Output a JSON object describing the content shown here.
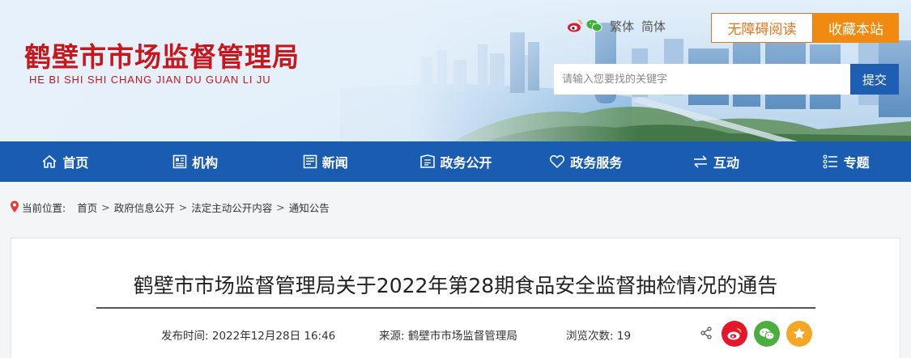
{
  "header": {
    "site_title": "鹤壁市市场监督管理局",
    "site_pinyin": "HE BI SHI SHI CHANG JIAN DU GUAN LI JU",
    "social_icons": [
      "weibo-icon",
      "wechat-icon"
    ],
    "lang_traditional": "繁体",
    "lang_simplified": "简体",
    "accessibility_label": "无障碍阅读",
    "favorite_label": "收藏本站",
    "search_placeholder": "请输入您要找的关键字",
    "search_button": "提交",
    "colors": {
      "title_red": "#c8161d",
      "fav_orange": "#f08a10",
      "nav_blue": "#1b5cb3"
    }
  },
  "nav": {
    "items": [
      {
        "label": "首页",
        "icon": "home-icon"
      },
      {
        "label": "机构",
        "icon": "org-icon"
      },
      {
        "label": "新闻",
        "icon": "news-icon"
      },
      {
        "label": "政务公开",
        "icon": "open-gov-icon"
      },
      {
        "label": "政务服务",
        "icon": "heart-icon"
      },
      {
        "label": "互动",
        "icon": "exchange-icon"
      },
      {
        "label": "专题",
        "icon": "topic-icon"
      }
    ]
  },
  "breadcrumb": {
    "label": "当前位置:",
    "items": [
      "首页",
      "政府信息公开",
      "法定主动公开内容",
      "通知公告"
    ],
    "separator": ">"
  },
  "article": {
    "title": "鹤壁市市场监督管理局关于2022年第28期食品安全监督抽检情况的通告",
    "publish_label": "发布时间:",
    "publish_time": "2022年12月28日 16:46",
    "source_label": "来源:",
    "source": "鹤壁市市场监督管理局",
    "views_label": "浏览次数:",
    "views": "19",
    "share_buttons": [
      "weibo-icon",
      "wechat-icon",
      "favorite-star-icon"
    ]
  }
}
